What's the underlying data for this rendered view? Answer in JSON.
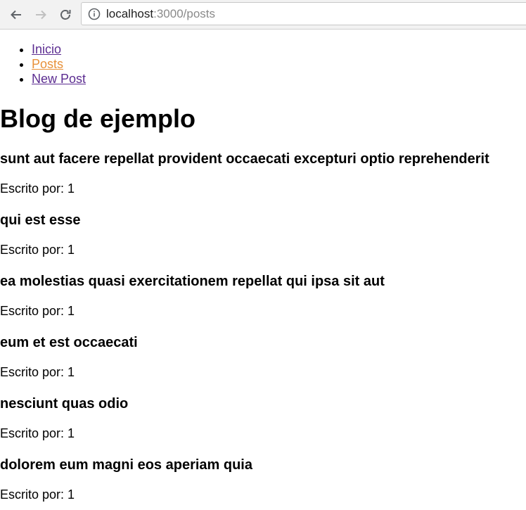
{
  "browser": {
    "url_host": "localhost",
    "url_rest": ":3000/posts"
  },
  "nav": {
    "items": [
      {
        "label": "Inicio",
        "active": false
      },
      {
        "label": "Posts",
        "active": true
      },
      {
        "label": "New Post",
        "active": false
      }
    ]
  },
  "page": {
    "title": "Blog de ejemplo"
  },
  "posts": [
    {
      "title": "sunt aut facere repellat provident occaecati excepturi optio reprehenderit",
      "author": "Escrito por: 1"
    },
    {
      "title": "qui est esse",
      "author": "Escrito por: 1"
    },
    {
      "title": "ea molestias quasi exercitationem repellat qui ipsa sit aut",
      "author": "Escrito por: 1"
    },
    {
      "title": "eum et est occaecati",
      "author": "Escrito por: 1"
    },
    {
      "title": "nesciunt quas odio",
      "author": "Escrito por: 1"
    },
    {
      "title": "dolorem eum magni eos aperiam quia",
      "author": "Escrito por: 1"
    }
  ],
  "colors": {
    "link": "#5c2d91",
    "link_active": "#e8913a"
  }
}
